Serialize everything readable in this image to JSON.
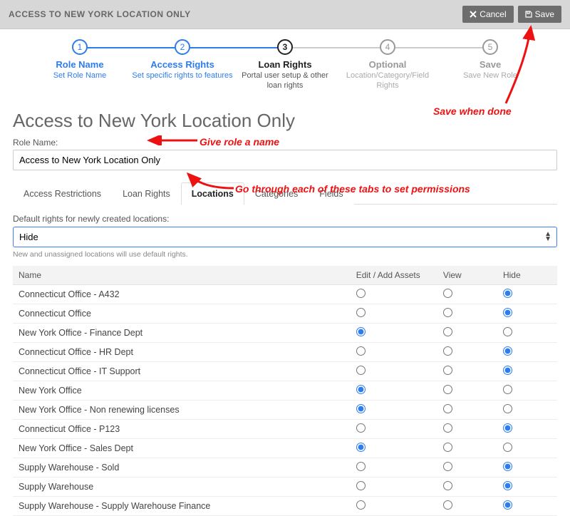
{
  "header": {
    "title": "ACCESS TO NEW YORK LOCATION ONLY",
    "cancel": "Cancel",
    "save": "Save"
  },
  "wizard": {
    "steps": [
      {
        "num": "1",
        "title": "Role Name",
        "sub": "Set Role Name",
        "state": "active"
      },
      {
        "num": "2",
        "title": "Access Rights",
        "sub": "Set specific rights to features",
        "state": "active"
      },
      {
        "num": "3",
        "title": "Loan Rights",
        "sub": "Portal user setup & other loan rights",
        "state": "current"
      },
      {
        "num": "4",
        "title": "Optional",
        "sub": "Location/Category/Field Rights",
        "state": "inactive"
      },
      {
        "num": "5",
        "title": "Save",
        "sub": "Save New Role",
        "state": "inactive"
      }
    ]
  },
  "page": {
    "heading": "Access to New York Location Only",
    "roleNameLabel": "Role Name:",
    "roleNameValue": "Access to New York Location Only"
  },
  "tabs": [
    "Access Restrictions",
    "Loan Rights",
    "Locations",
    "Categories",
    "Fields"
  ],
  "activeTab": "Locations",
  "defaults": {
    "label": "Default rights for newly created locations:",
    "value": "Hide",
    "hint": "New and unassigned locations will use default rights."
  },
  "table": {
    "columns": [
      "Name",
      "Edit / Add Assets",
      "View",
      "Hide"
    ],
    "rows": [
      {
        "name": "Connecticut Office - A432",
        "sel": "hide"
      },
      {
        "name": "Connecticut Office",
        "sel": "hide"
      },
      {
        "name": "New York Office - Finance Dept",
        "sel": "edit"
      },
      {
        "name": "Connecticut Office - HR Dept",
        "sel": "hide"
      },
      {
        "name": "Connecticut Office - IT Support",
        "sel": "hide"
      },
      {
        "name": "New York Office",
        "sel": "edit"
      },
      {
        "name": "New York Office - Non renewing licenses",
        "sel": "edit"
      },
      {
        "name": "Connecticut Office - P123",
        "sel": "hide"
      },
      {
        "name": "New York Office - Sales Dept",
        "sel": "edit"
      },
      {
        "name": "Supply Warehouse - Sold",
        "sel": "hide"
      },
      {
        "name": "Supply Warehouse",
        "sel": "hide"
      },
      {
        "name": "Supply Warehouse - Supply Warehouse Finance",
        "sel": "hide"
      }
    ]
  },
  "annotations": {
    "saveDone": "Save when done",
    "giveName": "Give role a name",
    "goTabs": "Go through each of these tabs to set permissions"
  }
}
